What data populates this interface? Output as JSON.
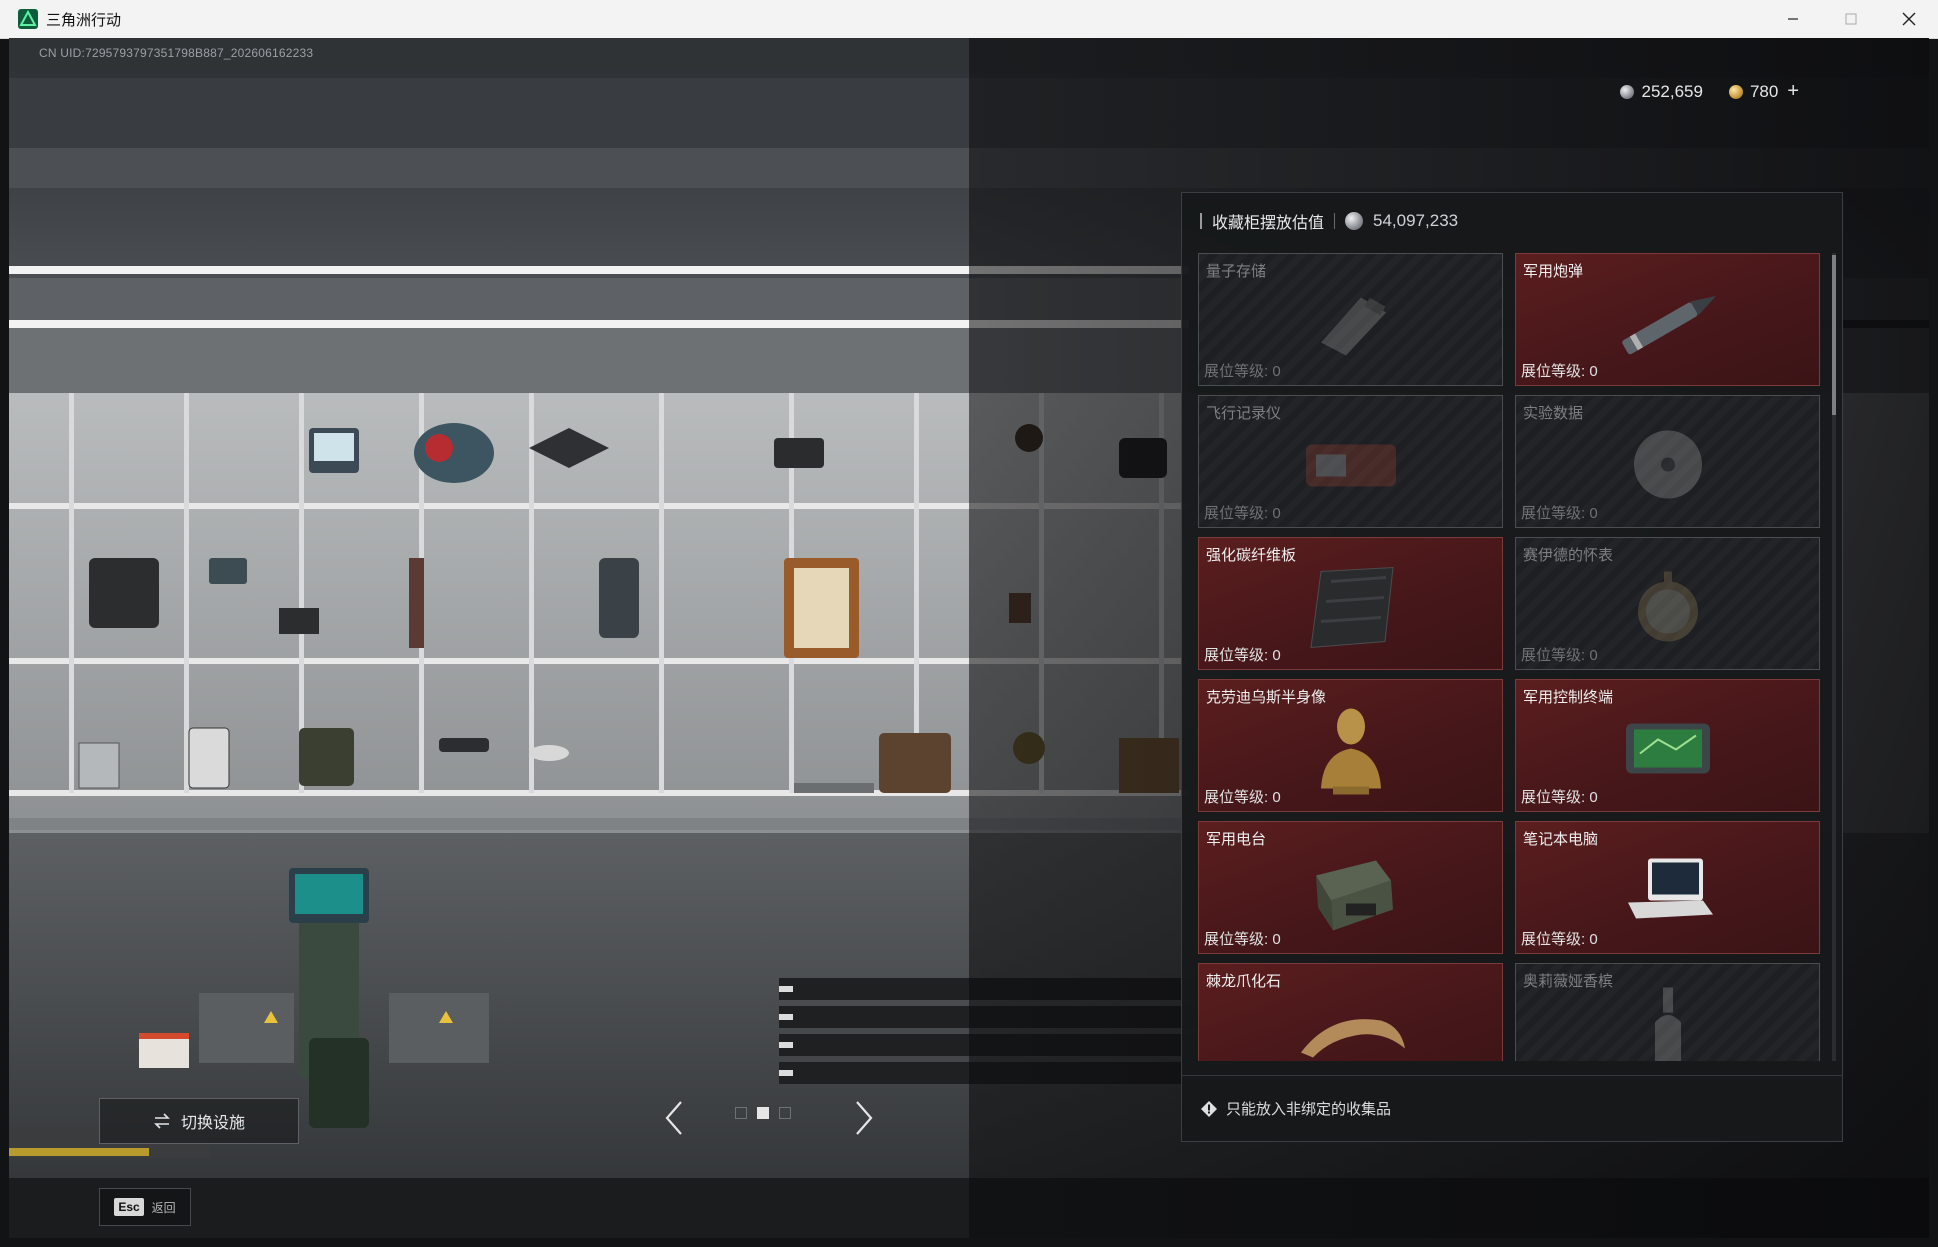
{
  "window": {
    "title": "三角洲行动"
  },
  "game": {
    "uid": "CN UID:7295793797351798B887_202606162233",
    "currency": {
      "silver": "252,659",
      "gold": "780",
      "add_label": "+"
    }
  },
  "panel": {
    "title": "收藏柜摆放估值",
    "value": "54,097,233",
    "level_label": "展位等级:  0",
    "footer_note": "只能放入非绑定的收集品",
    "slots": [
      {
        "name": "量子存储",
        "filled": false,
        "icon": "usb-drive-icon"
      },
      {
        "name": "军用炮弹",
        "filled": true,
        "icon": "artillery-shell-icon"
      },
      {
        "name": "飞行记录仪",
        "filled": false,
        "icon": "flight-recorder-icon"
      },
      {
        "name": "实验数据",
        "filled": false,
        "icon": "data-disc-icon"
      },
      {
        "name": "强化碳纤维板",
        "filled": true,
        "icon": "carbon-fiber-plate-icon"
      },
      {
        "name": "赛伊德的怀表",
        "filled": false,
        "icon": "pocket-watch-icon"
      },
      {
        "name": "克劳迪乌斯半身像",
        "filled": true,
        "icon": "bust-statue-icon"
      },
      {
        "name": "军用控制终端",
        "filled": true,
        "icon": "control-terminal-icon"
      },
      {
        "name": "军用电台",
        "filled": true,
        "icon": "military-radio-icon"
      },
      {
        "name": "笔记本电脑",
        "filled": true,
        "icon": "laptop-icon"
      },
      {
        "name": "棘龙爪化石",
        "filled": true,
        "icon": "claw-fossil-icon"
      },
      {
        "name": "奥莉薇娅香槟",
        "filled": false,
        "icon": "champagne-bottle-icon"
      }
    ]
  },
  "controls": {
    "switch_label": "切换设施",
    "esc_key": "Esc",
    "esc_label": "返回"
  },
  "colors": {
    "filled_slot": "#4f1b1d",
    "empty_slot": "#202225",
    "panel_bg": "#16181a"
  }
}
